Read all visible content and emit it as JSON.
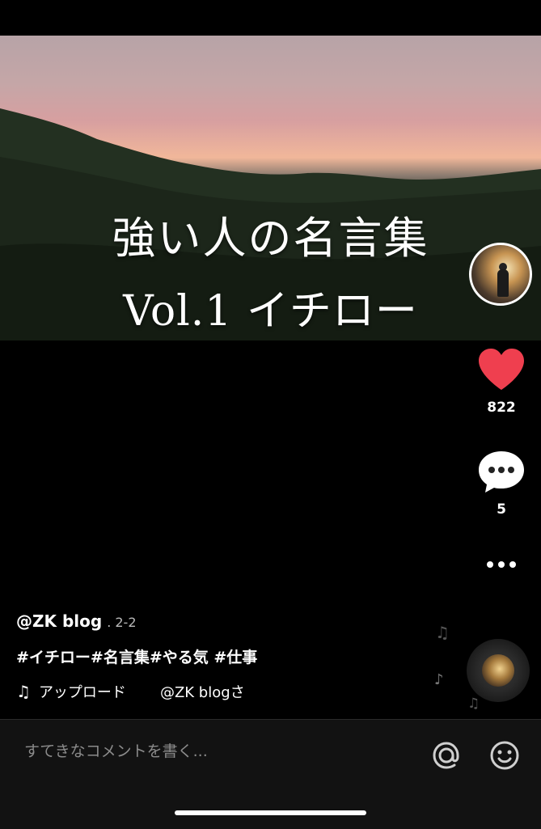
{
  "video": {
    "title_line1": "強い人の名言集",
    "title_line2": "Vol.1 イチロー"
  },
  "actions": {
    "likes": "822",
    "comments": "5"
  },
  "post": {
    "username": "@ZK blog",
    "date": ". 2-2",
    "hashtags": "#イチロー#名言集#やる気 #仕事",
    "music_label": "アップロード",
    "music_author": "@ZK blogさ"
  },
  "comment_bar": {
    "placeholder": "すてきなコメントを書く..."
  },
  "colors": {
    "heart": "#ef3f4f",
    "background": "#000000",
    "comment_bar": "#121212"
  }
}
